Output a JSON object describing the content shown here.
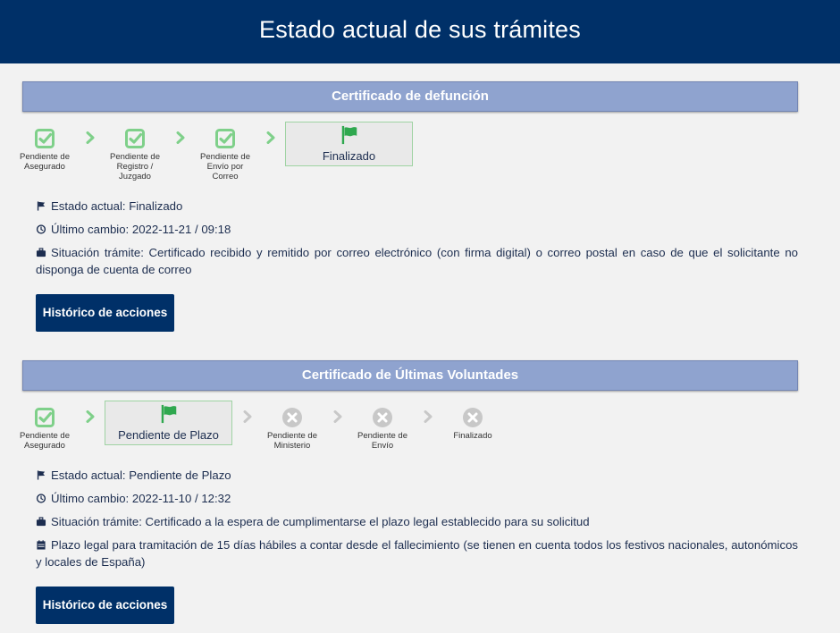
{
  "header": {
    "title": "Estado actual de sus trámites"
  },
  "section1": {
    "title": "Certificado de defunción",
    "steps": [
      {
        "label": "Pendiente de Asegurado"
      },
      {
        "label": "Pendiente de Registro / Juzgado"
      },
      {
        "label": "Pendiente de Envío por Correo"
      },
      {
        "label": "Finalizado"
      }
    ],
    "estado": "Estado actual: Finalizado",
    "ultimo_cambio": "Último cambio: 2022-11-21 / 09:18",
    "situacion": "Situación trámite: Certificado recibido y remitido por correo electrónico (con firma digital) o correo postal en caso de que el solicitante no disponga de cuenta de correo",
    "button": "Histórico de acciones"
  },
  "section2": {
    "title": "Certificado de Últimas Voluntades",
    "steps": [
      {
        "label": "Pendiente de Asegurado"
      },
      {
        "label": "Pendiente de Plazo"
      },
      {
        "label": "Pendiente de Ministerio"
      },
      {
        "label": "Pendiente de Envío"
      },
      {
        "label": "Finalizado"
      }
    ],
    "estado": "Estado actual: Pendiente de Plazo",
    "ultimo_cambio": "Último cambio: 2022-11-10 / 12:32",
    "situacion": "Situación trámite: Certificado a la espera de cumplimentarse el plazo legal establecido para su solicitud",
    "plazo": "Plazo legal para tramitación de 15 días hábiles a contar desde el fallecimiento (se tienen en cuenta todos los festivos nacionales, autonómicos y locales de España)",
    "button": "Histórico de acciones"
  },
  "icons": {
    "done": "check-square-icon",
    "current": "flag-icon",
    "pending": "x-circle-icon",
    "arrow": "chevron-right-icon",
    "estado": "small-flag-icon",
    "tiempo": "clock-icon",
    "situacion": "briefcase-icon",
    "plazo": "calendar-icon"
  },
  "colors": {
    "header": "#003068",
    "section": "#8fa3cf",
    "done": "#7fd08a",
    "flag": "#2fa84f",
    "pending": "#c8c8c8",
    "button": "#003068"
  }
}
